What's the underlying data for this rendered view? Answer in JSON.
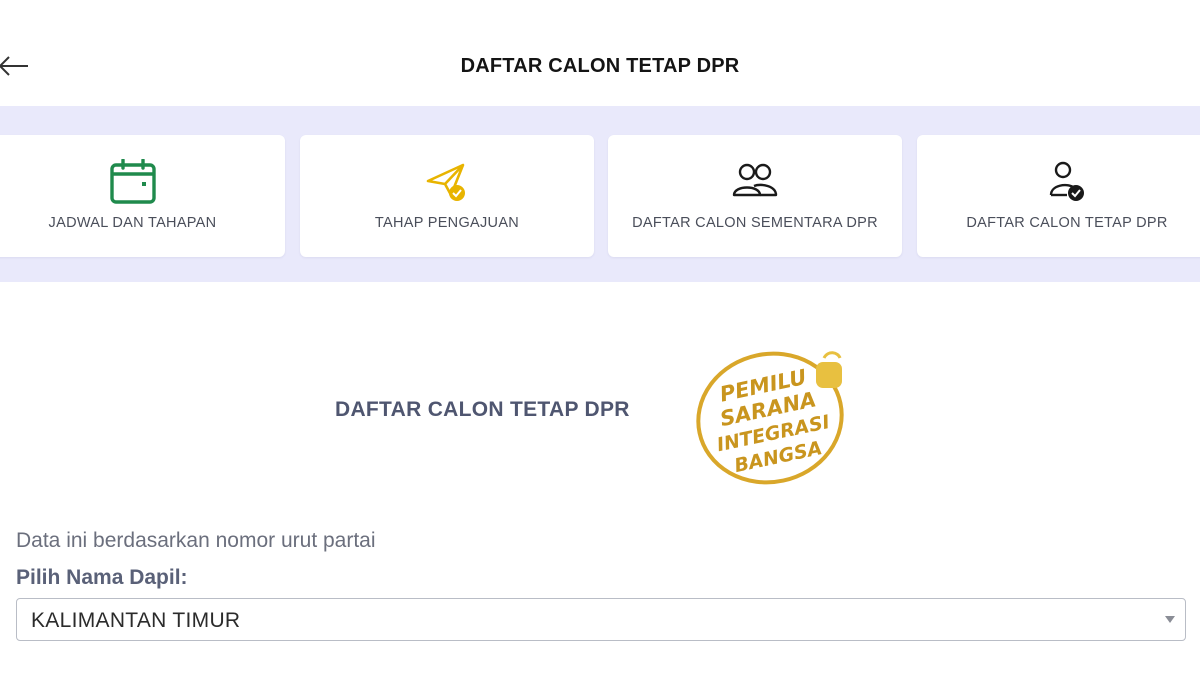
{
  "header": {
    "title": "DAFTAR CALON TETAP DPR",
    "back_icon": "arrow-left-icon"
  },
  "menu": {
    "items": [
      {
        "label": "JADWAL DAN TAHAPAN",
        "icon": "calendar-icon",
        "color": "#1f8a4c"
      },
      {
        "label": "TAHAP PENGAJUAN",
        "icon": "paper-plane-check-icon",
        "color": "#e8b400"
      },
      {
        "label": "DAFTAR CALON SEMENTARA DPR",
        "icon": "users-icon",
        "color": "#1a1a1a"
      },
      {
        "label": "DAFTAR CALON TETAP DPR",
        "icon": "user-check-icon",
        "color": "#1a1a1a"
      }
    ]
  },
  "main": {
    "title": "DAFTAR CALON TETAP DPR",
    "logo": {
      "lines": [
        "PEMILU",
        "SARANA",
        "INTEGRASI",
        "BANGSA"
      ],
      "color": "#d9a72a"
    },
    "info_text": "Data ini berdasarkan nomor urut partai",
    "dapil": {
      "label": "Pilih Nama Dapil:",
      "selected": "KALIMANTAN TIMUR"
    }
  }
}
